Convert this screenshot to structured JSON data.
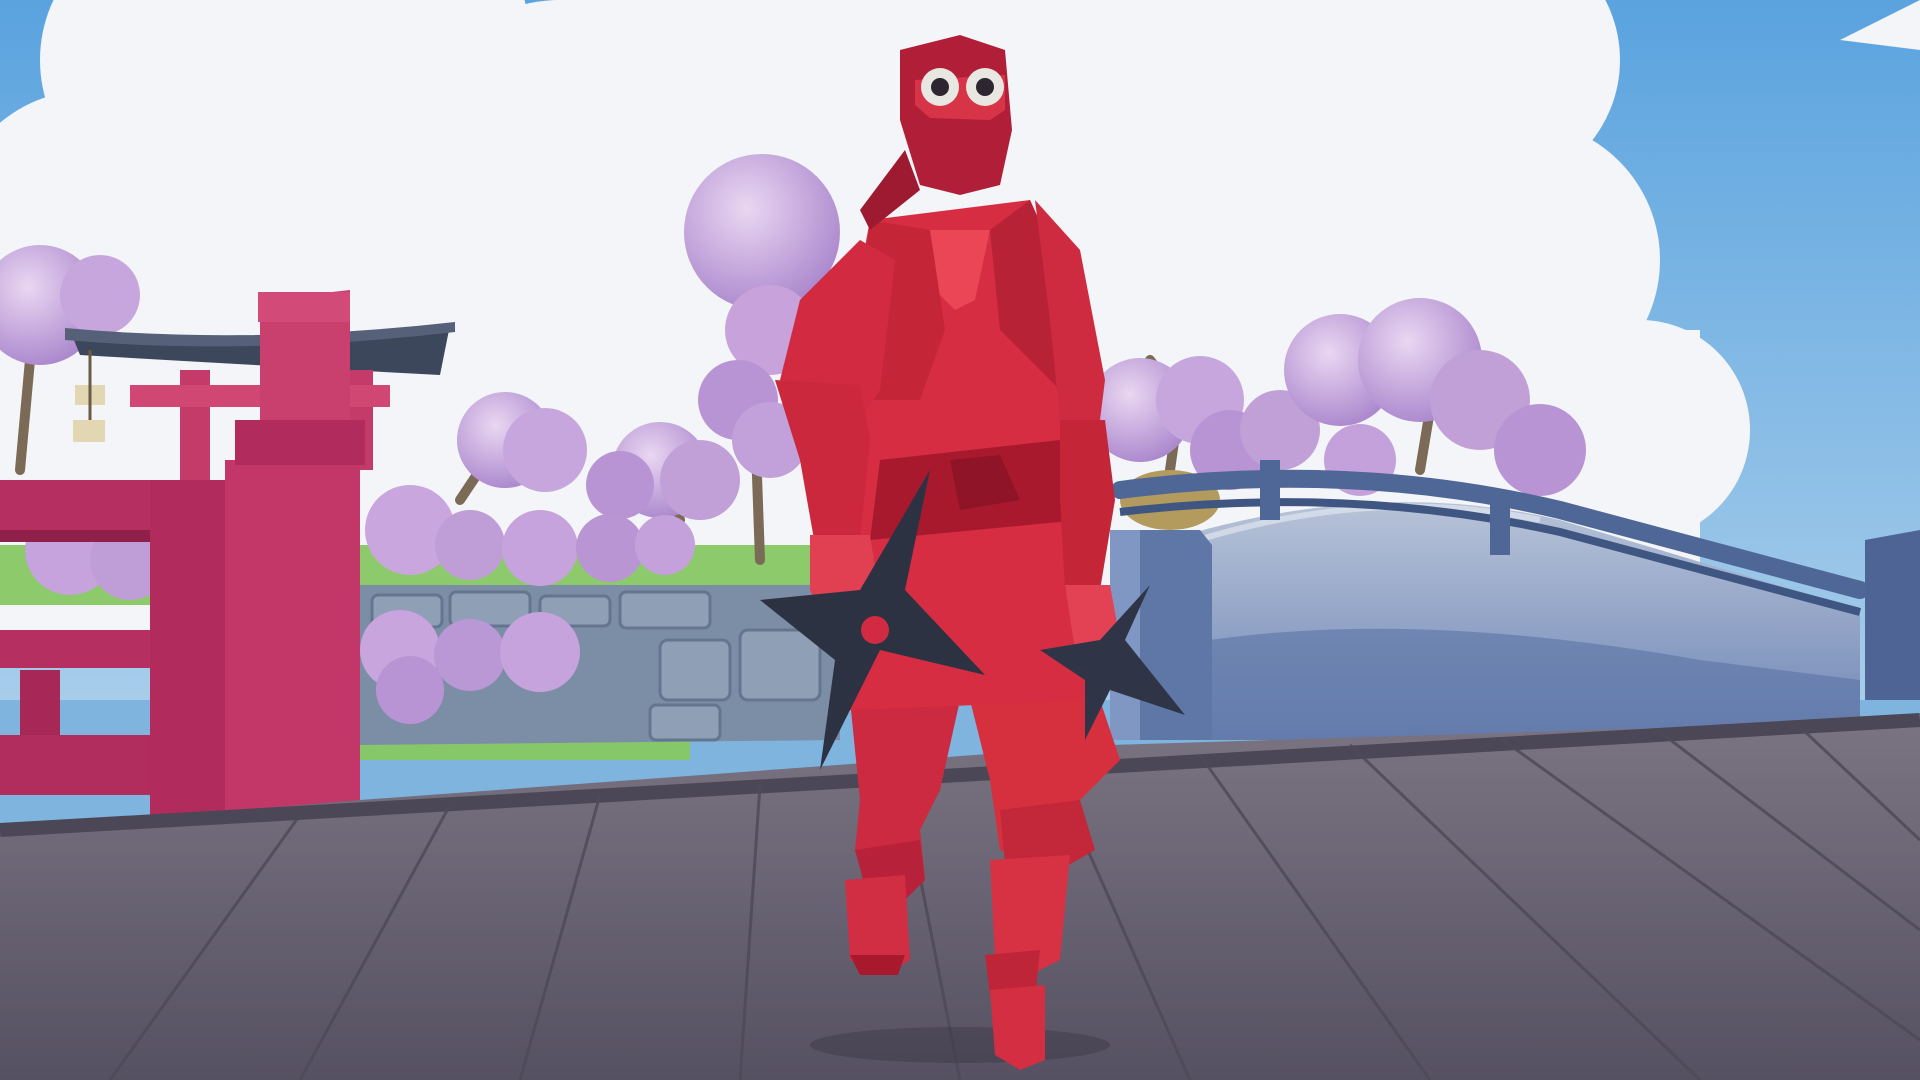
{
  "scene": {
    "kind": "3d-game-view",
    "setting": "japanese-garden-bridge",
    "character": "ninja",
    "weapon": "shuriken",
    "colors": {
      "sky": "#6fb0e4",
      "cloud": "#f4f6fa",
      "blossom": "#c9a6dd",
      "blossom_shade": "#9c7dc4",
      "torii": "#c93b6a",
      "torii_dark": "#a32a55",
      "roof": "#3f4a5e",
      "grass": "#86c76a",
      "stone_wall": "#7f90a6",
      "bridge_blue": "#7d95bf",
      "bridge_rail": "#4f6796",
      "deck": "#6f6a78",
      "deck_dark": "#5a5563",
      "ninja_red": "#d92d42",
      "ninja_dark": "#a8192e",
      "ninja_light": "#ea4655",
      "eye_white": "#e9e7e2",
      "shuriken": "#2c3242"
    }
  }
}
